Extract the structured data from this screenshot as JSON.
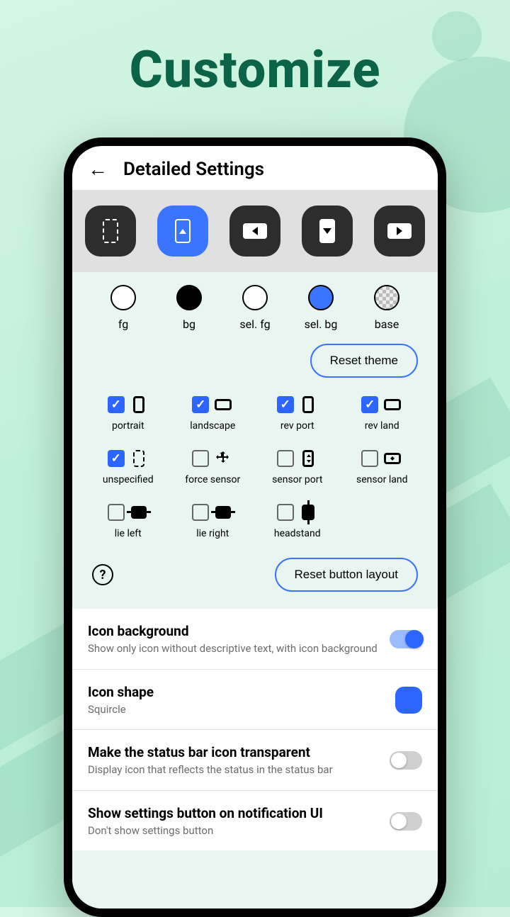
{
  "promo": {
    "title": "Customize"
  },
  "appbar": {
    "title": "Detailed Settings"
  },
  "swatches": [
    {
      "label": "fg"
    },
    {
      "label": "bg"
    },
    {
      "label": "sel. fg"
    },
    {
      "label": "sel. bg"
    },
    {
      "label": "base"
    }
  ],
  "buttons": {
    "reset_theme": "Reset theme",
    "reset_layout": "Reset button layout"
  },
  "grid": [
    {
      "label": "portrait",
      "checked": true
    },
    {
      "label": "landscape",
      "checked": true
    },
    {
      "label": "rev port",
      "checked": true
    },
    {
      "label": "rev land",
      "checked": true
    },
    {
      "label": "unspecified",
      "checked": true
    },
    {
      "label": "force sensor",
      "checked": false
    },
    {
      "label": "sensor port",
      "checked": false
    },
    {
      "label": "sensor land",
      "checked": false
    },
    {
      "label": "lie left",
      "checked": false
    },
    {
      "label": "lie right",
      "checked": false
    },
    {
      "label": "headstand",
      "checked": false
    }
  ],
  "settings": [
    {
      "title": "Icon background",
      "sub": "Show only icon without descriptive text, with icon background",
      "type": "toggle",
      "on": true
    },
    {
      "title": "Icon shape",
      "sub": "Squircle",
      "type": "shape"
    },
    {
      "title": "Make the status bar icon transparent",
      "sub": "Display icon that reflects the status in the status bar",
      "type": "toggle",
      "on": false
    },
    {
      "title": "Show settings button on notification UI",
      "sub": "Don't show settings button",
      "type": "toggle",
      "on": false
    }
  ],
  "colors": {
    "accent": "#2d66ff"
  }
}
